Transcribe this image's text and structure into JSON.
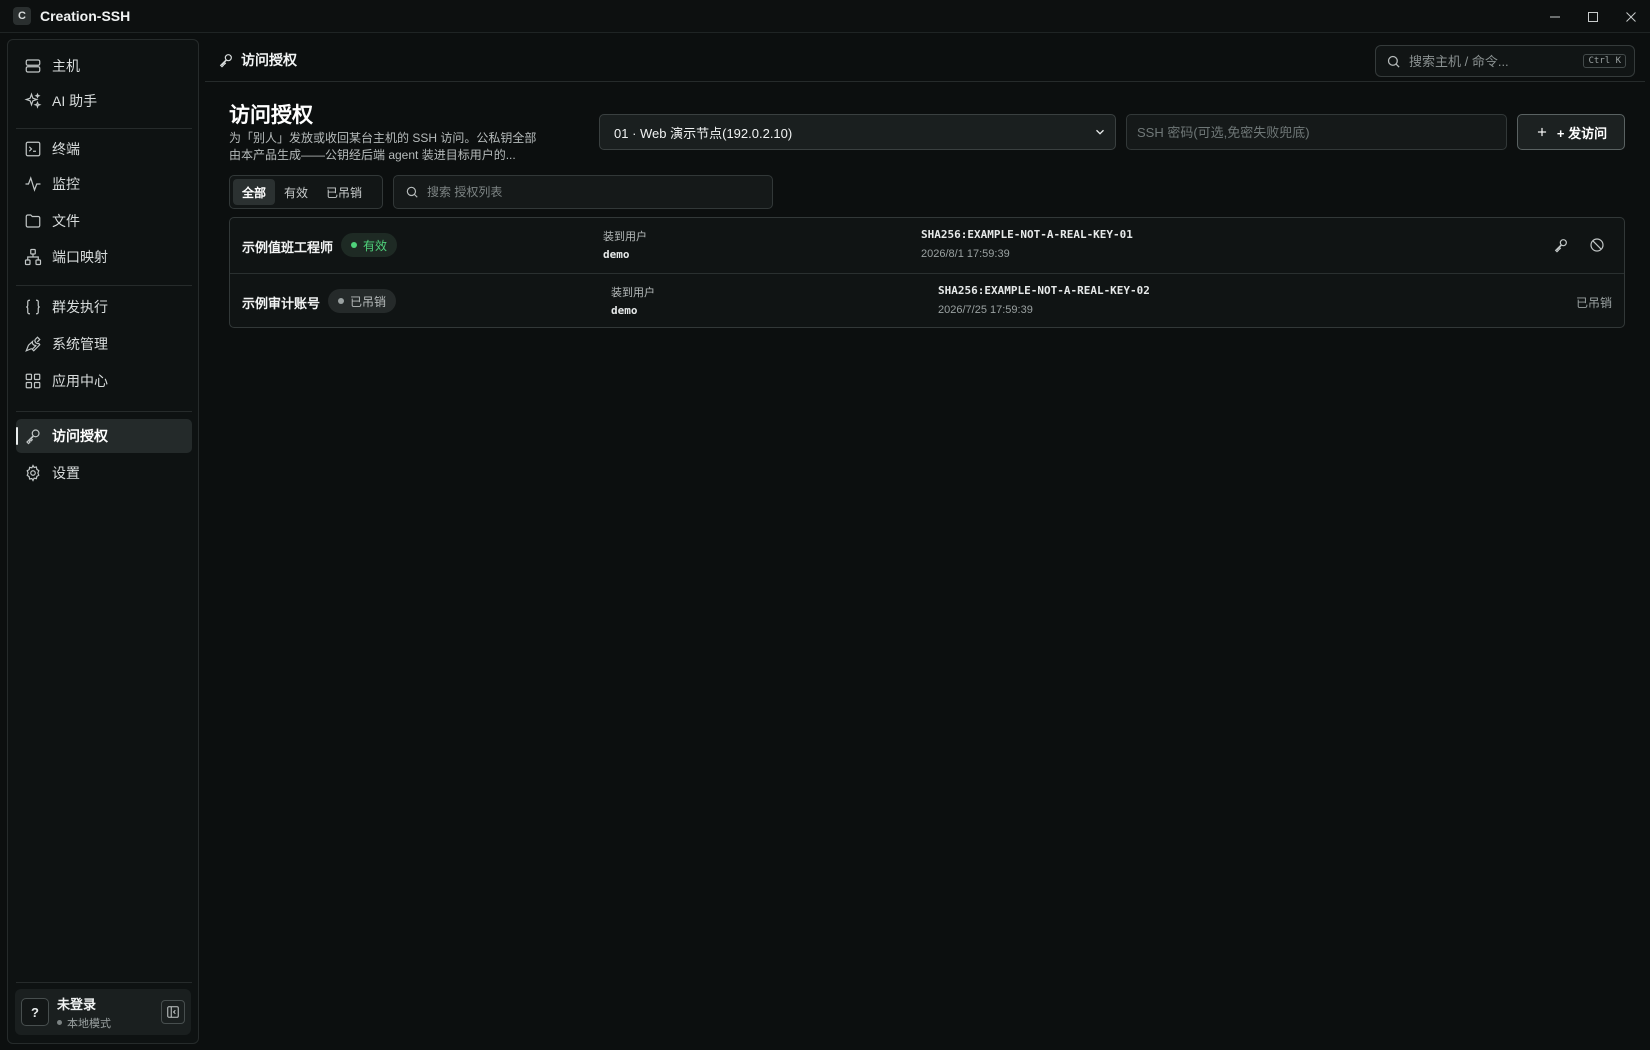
{
  "app": {
    "logo_letter": "C",
    "title": "Creation-SSH"
  },
  "sidebar": {
    "items": [
      {
        "label": "主机",
        "icon": "server-icon"
      },
      {
        "label": "AI 助手",
        "icon": "sparkles-icon"
      },
      {
        "label": "终端",
        "icon": "terminal-icon"
      },
      {
        "label": "监控",
        "icon": "activity-icon"
      },
      {
        "label": "文件",
        "icon": "folder-icon"
      },
      {
        "label": "端口映射",
        "icon": "network-icon"
      },
      {
        "label": "群发执行",
        "icon": "braces-icon"
      },
      {
        "label": "系统管理",
        "icon": "wrench-icon"
      },
      {
        "label": "应用中心",
        "icon": "grid-icon"
      },
      {
        "label": "访问授权",
        "icon": "key-icon",
        "active": true
      },
      {
        "label": "设置",
        "icon": "gear-icon"
      }
    ],
    "user": {
      "avatar": "?",
      "name": "未登录",
      "mode": "本地模式"
    }
  },
  "header": {
    "title": "访问授权",
    "search_placeholder": "搜索主机 / 命令...",
    "search_shortcut": "Ctrl K"
  },
  "main": {
    "title": "访问授权",
    "description": "为「别人」发放或收回某台主机的 SSH 访问。公私钥全部由本产品生成——公钥经后端 agent 装进目标用户的...",
    "host_select": "01 · Web 演示节点(192.0.2.10)",
    "password_placeholder": "SSH 密码(可选,免密失败兜底)",
    "issue_button": "+ 发访问",
    "filter_tabs": [
      "全部",
      "有效",
      "已吊销"
    ],
    "active_filter": "全部",
    "list_search_placeholder": "搜索 授权列表"
  },
  "grants": [
    {
      "name": "示例值班工程师",
      "status": "有效",
      "user_label": "装到用户",
      "user": "demo",
      "fingerprint": "SHA256:EXAMPLE-NOT-A-REAL-KEY-01",
      "date": "2026/8/1 17:59:39"
    },
    {
      "name": "示例审计账号",
      "status": "已吊销",
      "user_label": "装到用户",
      "user": "demo",
      "fingerprint": "SHA256:EXAMPLE-NOT-A-REAL-KEY-02",
      "date": "2026/7/25 17:59:39",
      "state_text": "已吊销"
    }
  ],
  "colors": {
    "background": "#0c0f0f",
    "valid": "#4fd27b",
    "active_nav": "#242a2a"
  }
}
